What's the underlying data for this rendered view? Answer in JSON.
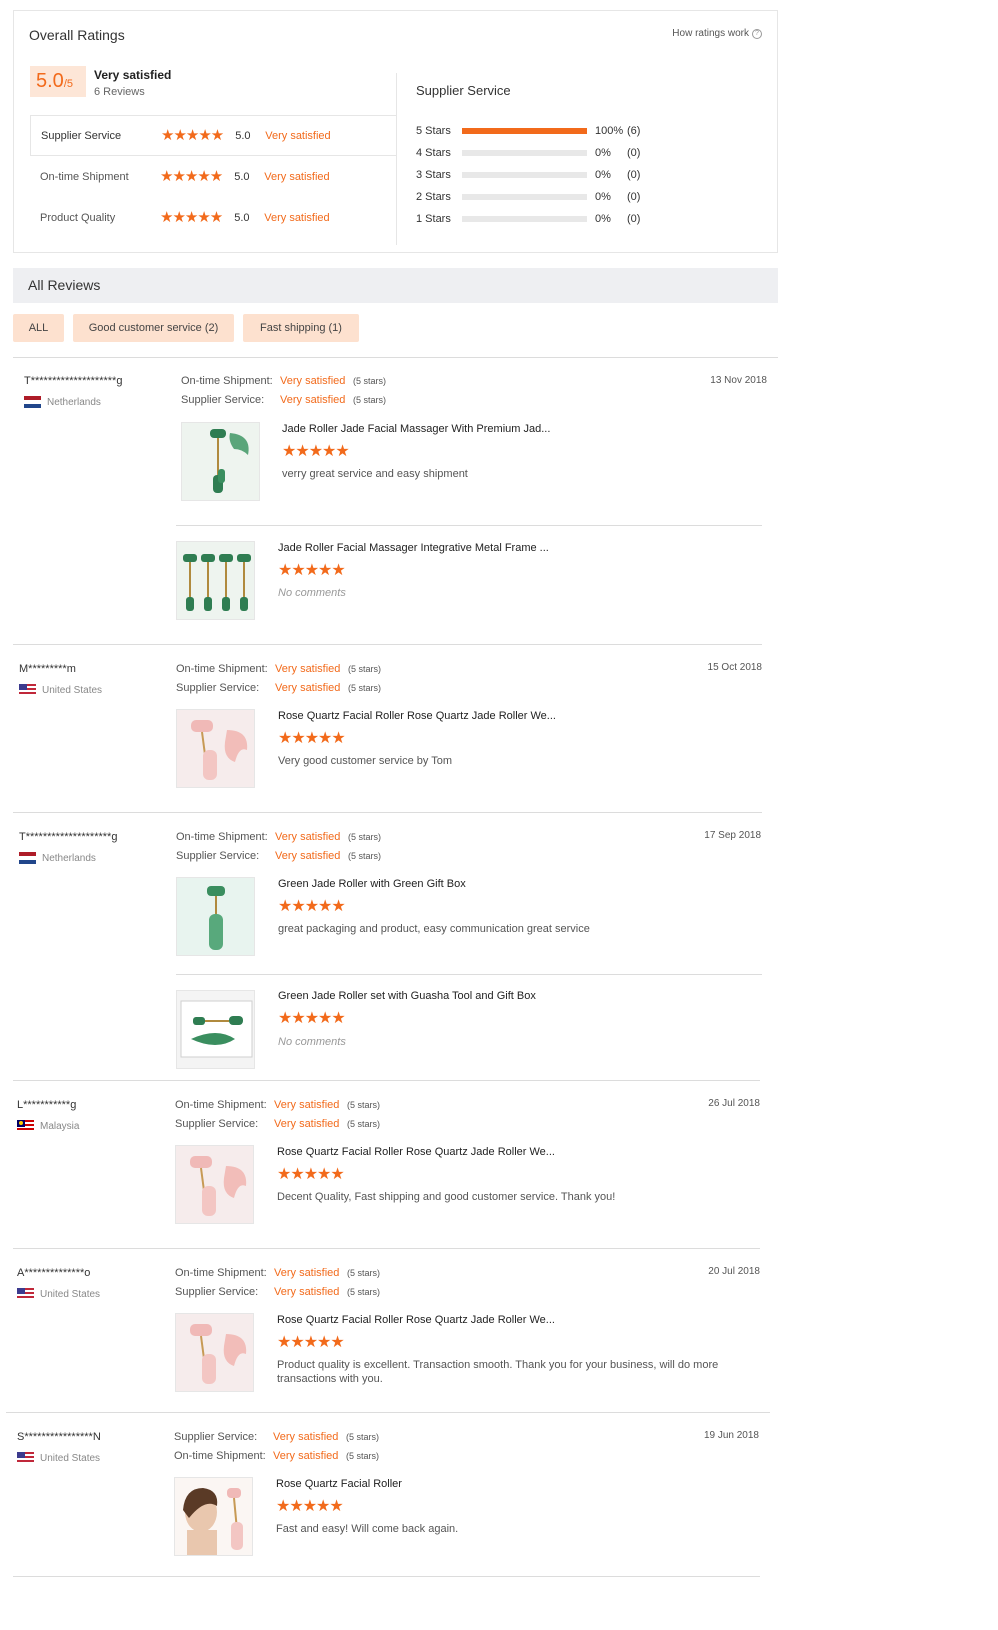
{
  "overall": {
    "title": "Overall Ratings",
    "how_link": "How ratings work",
    "score": "5.0",
    "score_den": "/5",
    "summary": "Very satisfied",
    "reviews_count": "6 Reviews",
    "dimensions": [
      {
        "label": "Supplier Service",
        "score": "5.0",
        "text": "Very satisfied",
        "stars": "★★★★★"
      },
      {
        "label": "On-time Shipment",
        "score": "5.0",
        "text": "Very satisfied",
        "stars": "★★★★★"
      },
      {
        "label": "Product Quality",
        "score": "5.0",
        "text": "Very satisfied",
        "stars": "★★★★★"
      }
    ]
  },
  "supplier_service": {
    "title": "Supplier Service",
    "rows": [
      {
        "label": "5 Stars",
        "pct": "100%",
        "count": "(6)",
        "fraction": 1.0
      },
      {
        "label": "4 Stars",
        "pct": "0%",
        "count": "(0)",
        "fraction": 0
      },
      {
        "label": "3 Stars",
        "pct": "0%",
        "count": "(0)",
        "fraction": 0
      },
      {
        "label": "2 Stars",
        "pct": "0%",
        "count": "(0)",
        "fraction": 0
      },
      {
        "label": "1 Stars",
        "pct": "0%",
        "count": "(0)",
        "fraction": 0
      }
    ]
  },
  "all_reviews": {
    "title": "All Reviews",
    "filters": [
      "ALL",
      "Good customer service (2)",
      "Fast shipping (1)"
    ]
  },
  "reviews": [
    {
      "user": "T********************g",
      "country": "Netherlands",
      "date": "13 Nov 2018",
      "meta": [
        {
          "label": "On-time Shipment:",
          "value": "Very satisfied",
          "stars": "(5 stars)"
        },
        {
          "label": "Supplier Service:",
          "value": "Very satisfied",
          "stars": "(5 stars)"
        }
      ],
      "products": [
        {
          "title": "Jade Roller Jade Facial Massager With Premium Jad...",
          "stars": "★★★★★",
          "comment": "verry great service and easy shipment"
        },
        {
          "title": "Jade Roller Facial Massager Integrative Metal Frame ...",
          "stars": "★★★★★",
          "comment": "No comments"
        }
      ]
    },
    {
      "user": "M*********m",
      "country": "United States",
      "date": "15 Oct 2018",
      "meta": [
        {
          "label": "On-time Shipment:",
          "value": "Very satisfied",
          "stars": "(5 stars)"
        },
        {
          "label": "Supplier Service:",
          "value": "Very satisfied",
          "stars": "(5 stars)"
        }
      ],
      "products": [
        {
          "title": "Rose Quartz Facial Roller Rose Quartz Jade Roller We...",
          "stars": "★★★★★",
          "comment": "Very good customer service by Tom"
        }
      ]
    },
    {
      "user": "T********************g",
      "country": "Netherlands",
      "date": "17 Sep 2018",
      "meta": [
        {
          "label": "On-time Shipment:",
          "value": "Very satisfied",
          "stars": "(5 stars)"
        },
        {
          "label": "Supplier Service:",
          "value": "Very satisfied",
          "stars": "(5 stars)"
        }
      ],
      "products": [
        {
          "title": "Green Jade Roller with Green Gift Box",
          "stars": "★★★★★",
          "comment": "great packaging and product, easy communication great service"
        },
        {
          "title": "Green Jade Roller set with Guasha Tool and Gift Box",
          "stars": "★★★★★",
          "comment": "No comments"
        }
      ]
    },
    {
      "user": "L***********g",
      "country": "Malaysia",
      "date": "26 Jul 2018",
      "meta": [
        {
          "label": "On-time Shipment:",
          "value": "Very satisfied",
          "stars": "(5 stars)"
        },
        {
          "label": "Supplier Service:",
          "value": "Very satisfied",
          "stars": "(5 stars)"
        }
      ],
      "products": [
        {
          "title": "Rose Quartz Facial Roller Rose Quartz Jade Roller We...",
          "stars": "★★★★★",
          "comment": "Decent Quality, Fast shipping and good customer service. Thank you!"
        }
      ]
    },
    {
      "user": "A**************o",
      "country": "United States",
      "date": "20 Jul 2018",
      "meta": [
        {
          "label": "On-time Shipment:",
          "value": "Very satisfied",
          "stars": "(5 stars)"
        },
        {
          "label": "Supplier Service:",
          "value": "Very satisfied",
          "stars": "(5 stars)"
        }
      ],
      "products": [
        {
          "title": "Rose Quartz Facial Roller Rose Quartz Jade Roller We...",
          "stars": "★★★★★",
          "comment": "Product quality is excellent. Transaction smooth. Thank you for your business, will do more transactions with you."
        }
      ]
    },
    {
      "user": "S****************N",
      "country": "United States",
      "date": "19 Jun 2018",
      "meta": [
        {
          "label": "Supplier Service:",
          "value": "Very satisfied",
          "stars": "(5 stars)"
        },
        {
          "label": "On-time Shipment:",
          "value": "Very satisfied",
          "stars": "(5 stars)"
        }
      ],
      "products": [
        {
          "title": "Rose Quartz Facial Roller",
          "stars": "★★★★★",
          "comment": "Fast and easy! Will come back again."
        }
      ]
    }
  ],
  "colors": {
    "accent": "#f26a1b",
    "score_bg": "#fde6d7",
    "filter_bg": "#fde1cf",
    "header_bg": "#eeeff2"
  }
}
